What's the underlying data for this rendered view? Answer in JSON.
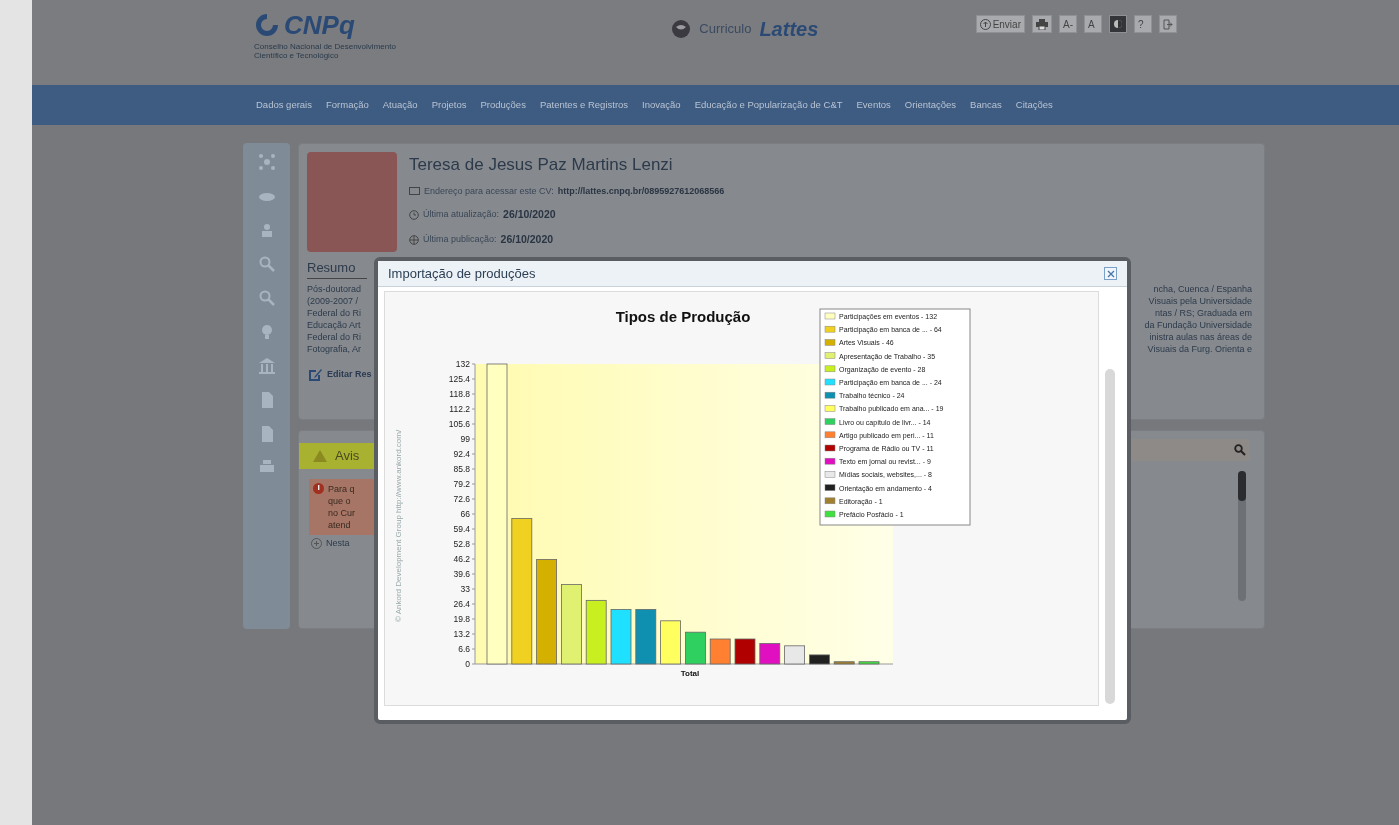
{
  "header": {
    "logo_text": "CNPq",
    "logo_subtitle": "Conselho Nacional de Desenvolvimento Científico e Tecnológico",
    "app_title_prefix": "Curriculo",
    "app_title": "Lattes",
    "tools": [
      {
        "kind": "send",
        "label": "Enviar"
      },
      {
        "kind": "print"
      },
      {
        "kind": "font-smaller",
        "label": "A-"
      },
      {
        "kind": "font-normal",
        "label": "A"
      },
      {
        "kind": "contrast"
      },
      {
        "kind": "help",
        "label": "?"
      },
      {
        "kind": "exit"
      }
    ]
  },
  "nav": [
    "Dados gerais",
    "Formação",
    "Atuação",
    "Projetos",
    "Produções",
    "Patentes e Registros",
    "Inovação",
    "Educação e Popularização de C&T",
    "Eventos",
    "Orientações",
    "Bancas",
    "Citações"
  ],
  "profile": {
    "name": "Teresa de Jesus Paz Martins Lenzi",
    "lines": [
      {
        "kind": "link",
        "label": "Endereço para acessar este CV:",
        "value": "http://lattes.cnpq.br/0895927612068566"
      },
      {
        "kind": "update",
        "label": "Última atualização:",
        "value": "26/10/2020"
      },
      {
        "kind": "publish",
        "label": "Última publicação:",
        "value": "26/10/2020"
      }
    ]
  },
  "summary": {
    "heading": "Resumo",
    "left_fragments": [
      "Pós-doutorad",
      "(2009-2007 /",
      "Federal do Ri",
      "Educação Art",
      "Federal do Ri",
      "Fotografia, Ar"
    ],
    "right_fragments": [
      "ncha, Cuenca / Espanha",
      "Visuais pela Universidade",
      "ntas / RS; Graduada em",
      "da Fundação Universidade",
      "inistra aulas nas áreas de",
      "Visuais da Furg. Orienta e"
    ],
    "edit_link": "Editar Res"
  },
  "notices": {
    "title": "Avis",
    "alert_lines": [
      "Para q",
      "que o",
      "no Cur",
      "atend"
    ],
    "note": "Nesta"
  },
  "modal": {
    "title": "Importação de produções",
    "credit": "© Ankord Development Group http://www.ankord.com/",
    "chart_data": {
      "type": "bar",
      "title": "Tipos de Produção",
      "categories": [
        "Total"
      ],
      "legend": "top-right",
      "ylim": [
        0,
        132
      ],
      "yticks": [
        0,
        6.6,
        13.2,
        19.8,
        26.4,
        33,
        39.6,
        46.2,
        52.8,
        59.4,
        66,
        72.6,
        79.2,
        85.8,
        92.4,
        99,
        105.6,
        112.2,
        118.8,
        125.4,
        132
      ],
      "series": [
        {
          "name": "Participações em eventos - 132",
          "color": "#ffffc0",
          "values": [
            132
          ]
        },
        {
          "name": "Participação em banca de ... - 64",
          "color": "#f0d020",
          "values": [
            64
          ]
        },
        {
          "name": "Artes Visuais - 46",
          "color": "#d4b000",
          "values": [
            46
          ]
        },
        {
          "name": "Apresentação de Trabalho - 35",
          "color": "#e0f070",
          "values": [
            35
          ]
        },
        {
          "name": "Organização de evento - 28",
          "color": "#c8f020",
          "values": [
            28
          ]
        },
        {
          "name": "Participação em banca de ... - 24",
          "color": "#20e0ff",
          "values": [
            24
          ]
        },
        {
          "name": "Trabalho técnico - 24",
          "color": "#1090b0",
          "values": [
            24
          ]
        },
        {
          "name": "Trabalho publicado em ana... - 19",
          "color": "#ffff60",
          "values": [
            19
          ]
        },
        {
          "name": "Livro ou capítulo de livr... - 14",
          "color": "#30d060",
          "values": [
            14
          ]
        },
        {
          "name": "Artigo publicado em peri... - 11",
          "color": "#ff8030",
          "values": [
            11
          ]
        },
        {
          "name": "Programa de Rádio ou TV - 11",
          "color": "#b00000",
          "values": [
            11
          ]
        },
        {
          "name": "Texto em jornal ou revist... - 9",
          "color": "#e010c0",
          "values": [
            9
          ]
        },
        {
          "name": "Mídias sociais, websites,... - 8",
          "color": "#e8e8e8",
          "values": [
            8
          ]
        },
        {
          "name": "Orientação em andamento - 4",
          "color": "#202020",
          "values": [
            4
          ]
        },
        {
          "name": "Editoração - 1",
          "color": "#a08030",
          "values": [
            1
          ]
        },
        {
          "name": "Prefácio Posfácio - 1",
          "color": "#40e040",
          "values": [
            1
          ]
        }
      ]
    }
  }
}
